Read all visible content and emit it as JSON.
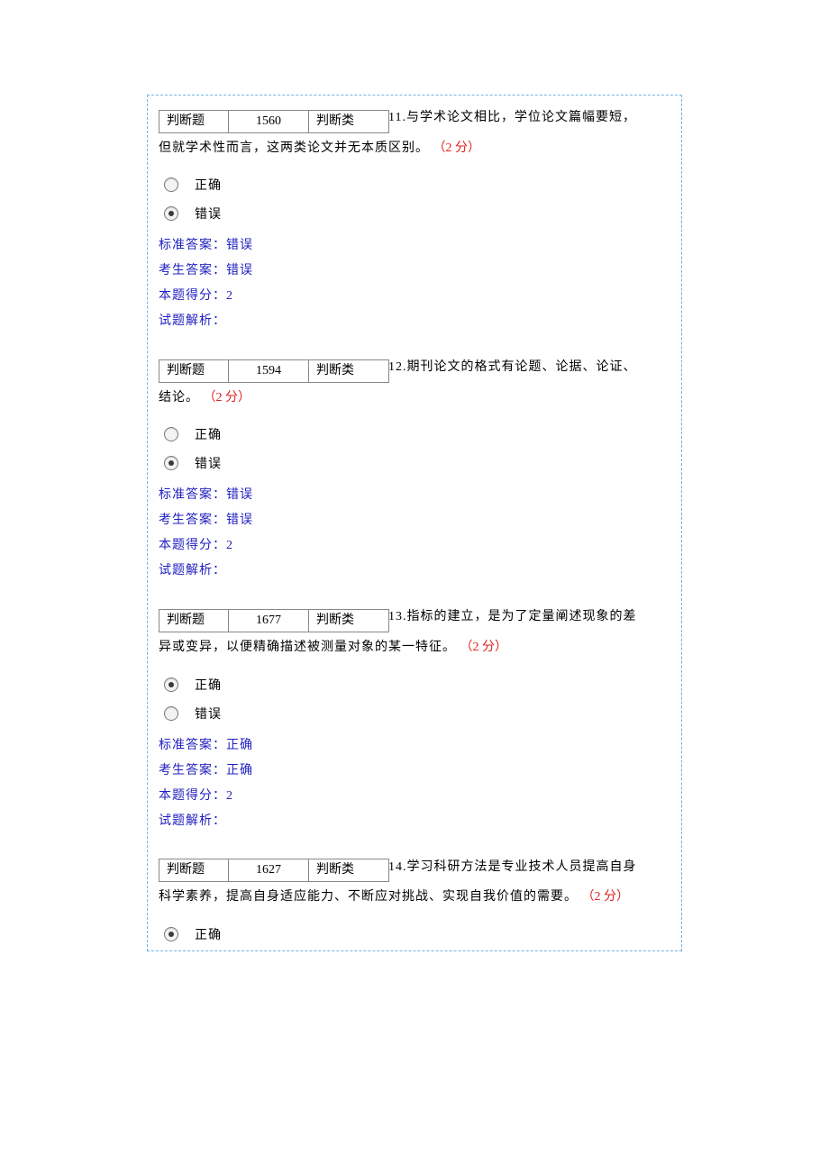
{
  "labels": {
    "correct_option": "正确",
    "wrong_option": "错误",
    "std_answer": "标准答案：",
    "user_answer": "考生答案：",
    "score": "本题得分：",
    "analysis": "试题解析："
  },
  "questions": [
    {
      "type1": "判断题",
      "number": "1560",
      "type2": "判断类",
      "index": "11.",
      "text_head": "与学术论文相比，学位论文篇幅要短，",
      "text_tail": "但就学术性而言，这两类论文并无本质区别。",
      "points": "（2 分）",
      "selected": "wrong",
      "std_answer": "错误",
      "user_answer": "错误",
      "score": "2",
      "analysis": ""
    },
    {
      "type1": "判断题",
      "number": "1594",
      "type2": "判断类",
      "index": "12.",
      "text_head": "期刊论文的格式有论题、论据、论证、",
      "text_tail": "结论。",
      "points": "（2 分）",
      "selected": "wrong",
      "std_answer": "错误",
      "user_answer": "错误",
      "score": "2",
      "analysis": ""
    },
    {
      "type1": "判断题",
      "number": "1677",
      "type2": "判断类",
      "index": "13.",
      "text_head": "指标的建立，是为了定量阐述现象的差",
      "text_tail": "异或变异，以便精确描述被测量对象的某一特征。",
      "points": "（2 分）",
      "selected": "correct",
      "std_answer": "正确",
      "user_answer": "正确",
      "score": "2",
      "analysis": ""
    },
    {
      "type1": "判断题",
      "number": "1627",
      "type2": "判断类",
      "index": "14.",
      "text_head": "学习科研方法是专业技术人员提高自身",
      "text_tail": "科学素养，提高自身适应能力、不断应对挑战、实现自我价值的需要。",
      "points": "（2 分）",
      "selected": "correct",
      "std_answer": "",
      "user_answer": "",
      "score": "",
      "analysis": "",
      "partial": true
    }
  ]
}
